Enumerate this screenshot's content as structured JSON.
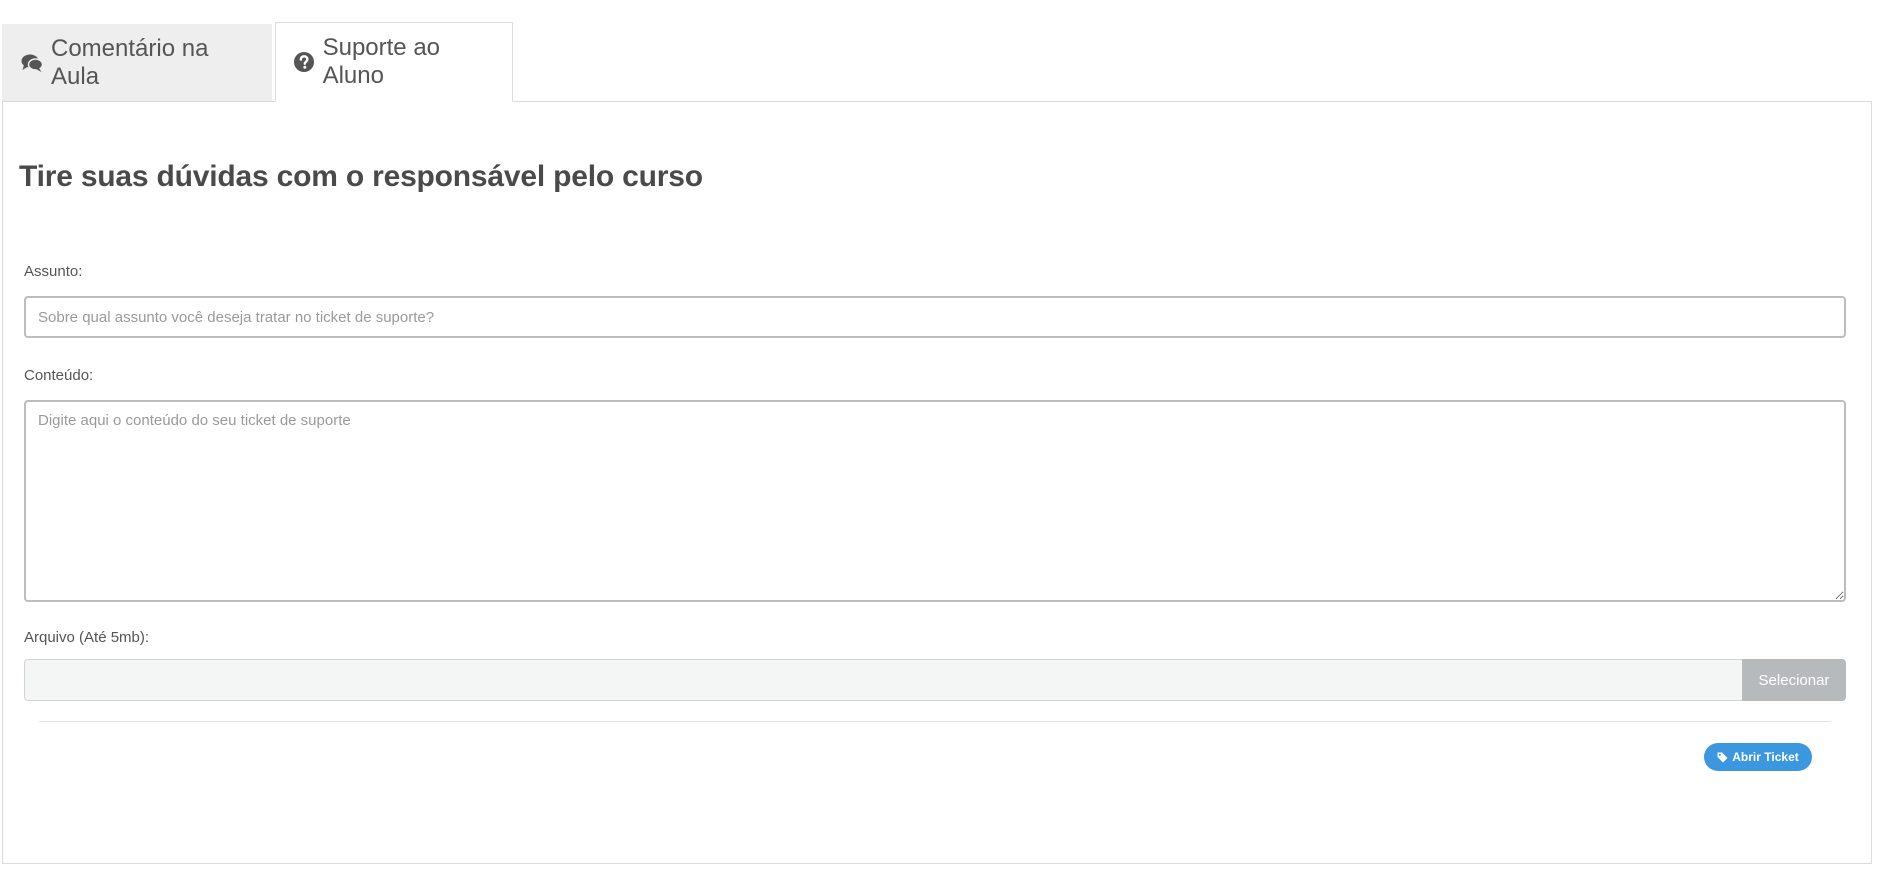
{
  "tabs": [
    {
      "label": "Comentário na Aula",
      "icon": "comments-icon",
      "active": false
    },
    {
      "label": "Suporte ao Aluno",
      "icon": "question-circle-icon",
      "active": true
    }
  ],
  "form": {
    "title": "Tire suas dúvidas com o responsável pelo curso",
    "subject": {
      "label": "Assunto:",
      "placeholder": "Sobre qual assunto você deseja tratar no ticket de suporte?",
      "value": ""
    },
    "content": {
      "label": "Conteúdo:",
      "placeholder": "Digite aqui o conteúdo do seu ticket de suporte",
      "value": ""
    },
    "file": {
      "label": "Arquivo (Até 5mb):",
      "button_label": "Selecionar"
    },
    "submit": {
      "label": "Abrir Ticket",
      "icon": "tag-icon"
    }
  },
  "colors": {
    "accent": "#3a97e0",
    "tab_inactive_bg": "#eeeeee",
    "file_button_bg": "#b7babd"
  }
}
